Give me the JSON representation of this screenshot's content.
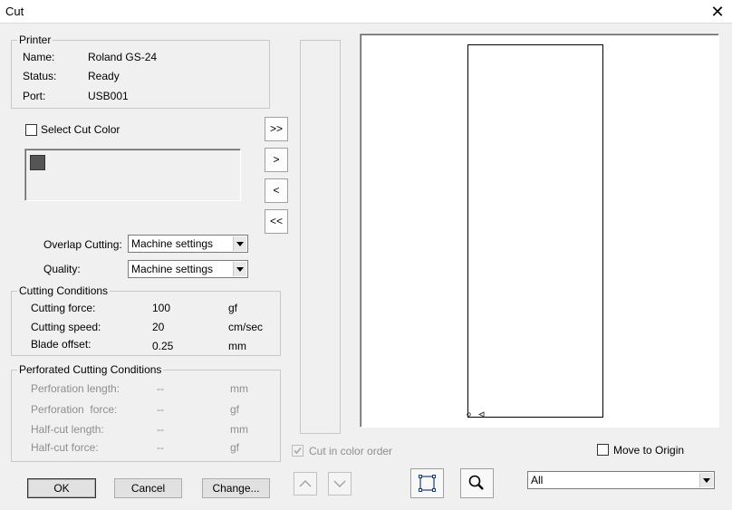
{
  "window": {
    "title": "Cut",
    "close_glyph": "✕"
  },
  "printer": {
    "group_title": "Printer",
    "name_label": "Name:",
    "name_value": "Roland GS-24",
    "status_label": "Status:",
    "status_value": "Ready",
    "port_label": "Port:",
    "port_value": "USB001"
  },
  "select_cut_color": {
    "label": "Select Cut Color",
    "checked": false
  },
  "color_swatches": [
    {
      "color": "#555555"
    }
  ],
  "transfer_buttons": {
    "all_right": ">>",
    "right": ">",
    "left": "<",
    "all_left": "<<"
  },
  "overlap_cutting": {
    "label": "Overlap Cutting:",
    "value": "Machine settings"
  },
  "quality": {
    "label": "Quality:",
    "value": "Machine settings"
  },
  "cutting_conditions": {
    "group_title": "Cutting Conditions",
    "rows": [
      {
        "label": "Cutting force:",
        "value": "100",
        "unit": "gf"
      },
      {
        "label": "Cutting speed:",
        "value": "20",
        "unit": "cm/sec"
      },
      {
        "label": "Blade offset:",
        "value": "0.25",
        "unit": "mm"
      }
    ]
  },
  "perforated_conditions": {
    "group_title": "Perforated Cutting Conditions",
    "rows": [
      {
        "label": "Perforation length:",
        "value": "--",
        "unit": "mm"
      },
      {
        "label": "Perforation  force:",
        "value": "--",
        "unit": "gf"
      },
      {
        "label": "Half-cut length:",
        "value": "--",
        "unit": "mm"
      },
      {
        "label": "Half-cut force:",
        "value": "--",
        "unit": "gf"
      }
    ]
  },
  "cut_in_color_order": {
    "label": "Cut in color order",
    "checked": true,
    "disabled": true
  },
  "move_to_origin": {
    "label": "Move to Origin",
    "checked": false
  },
  "view_filter": {
    "value": "All"
  },
  "buttons": {
    "ok": "OK",
    "cancel": "Cancel",
    "change": "Change..."
  },
  "colors": {
    "accent": "#000000",
    "swatch": "#555555",
    "disabled_text": "#8e8e8e"
  }
}
